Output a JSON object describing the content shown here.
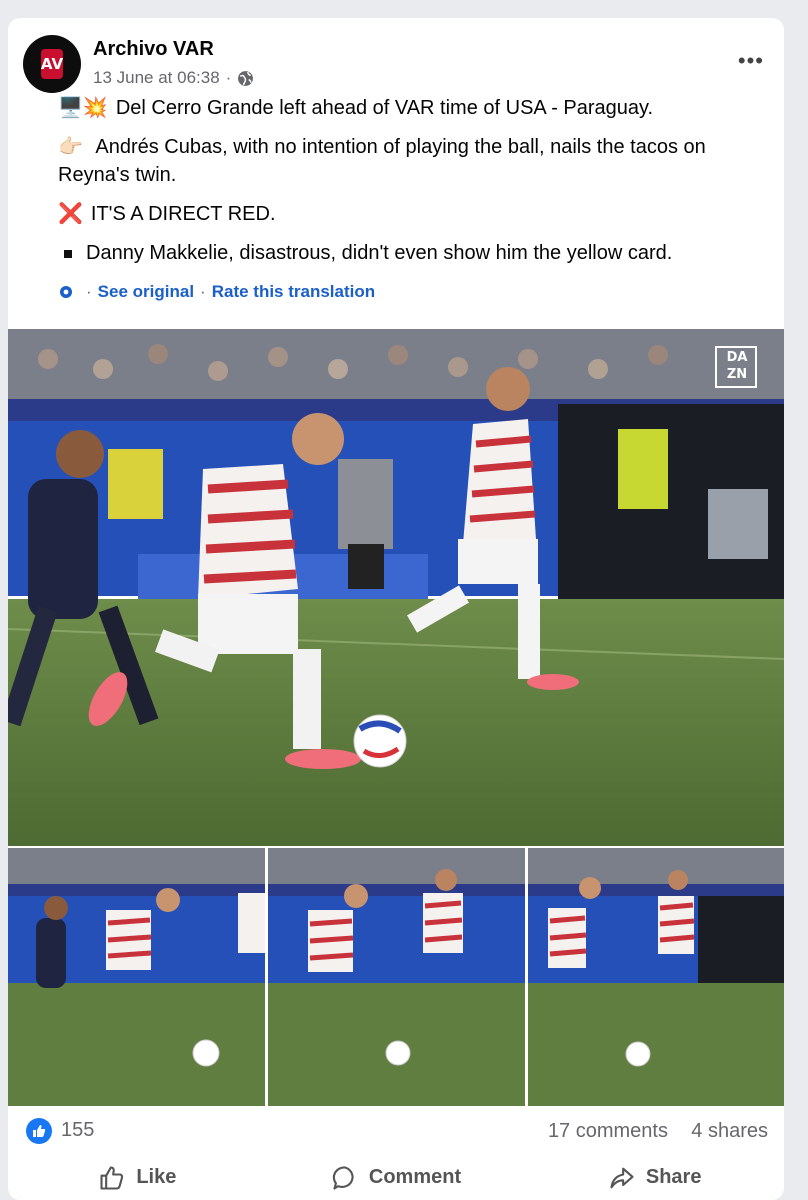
{
  "post": {
    "page_name": "Archivo VAR",
    "avatar_text": "AV",
    "timestamp": "13 June at 06:38",
    "separator": "·",
    "more": "•••",
    "lines": [
      {
        "emoji": "🖥️💥",
        "text": "Del Cerro Grande left ahead of VAR time of USA - Paraguay."
      },
      {
        "emoji": "👉🏻",
        "text": "Andrés Cubas, with no intention of playing the ball, nails the tacos on Reyna's twin."
      },
      {
        "emoji": "❌",
        "text": "IT'S A DIRECT RED."
      },
      {
        "emoji": "▪",
        "text": "Danny Makkelie, disastrous, didn't even show him the yellow card."
      }
    ],
    "see_original": "See original",
    "rate_translation": "Rate this translation",
    "dot": "·"
  },
  "media": {
    "watermark": "DA\nZN"
  },
  "stats": {
    "likes": "155",
    "comments": "17 comments",
    "shares": "4 shares"
  },
  "actions": {
    "like": "Like",
    "comment": "Comment",
    "share": "Share"
  },
  "colors": {
    "accent": "#1877f2",
    "link": "#1b5fc8",
    "pitch": "#5a7a3c",
    "stand_blue": "#2450b8"
  }
}
